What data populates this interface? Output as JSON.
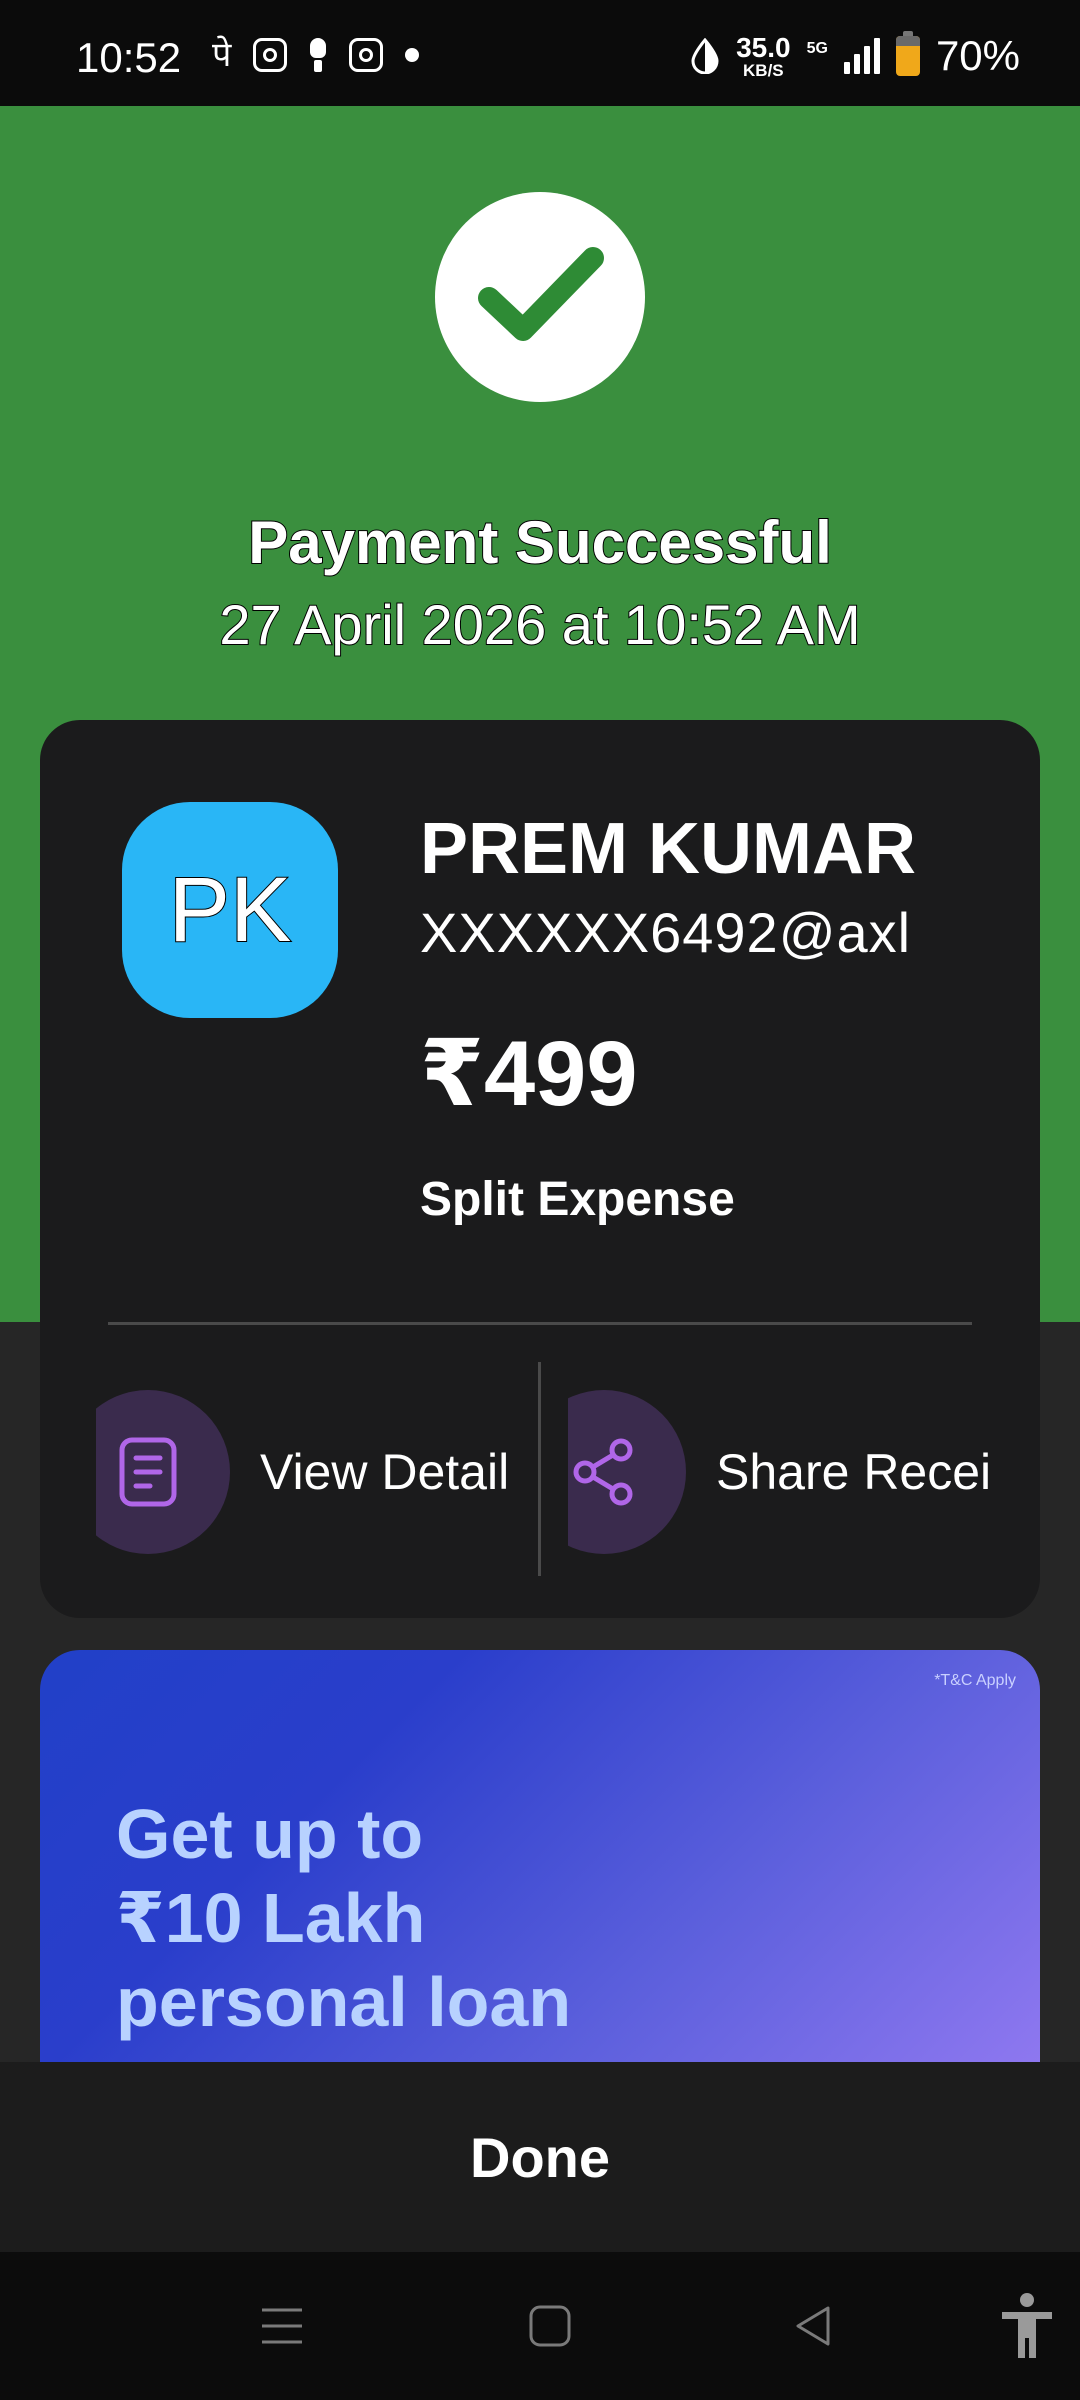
{
  "status_bar": {
    "time": "10:52",
    "notif_glyph": "पे",
    "net_speed_value": "35.0",
    "net_speed_unit": "KB/S",
    "network_type": "5G",
    "battery_percent": "70%",
    "battery_level": 0.7
  },
  "payment": {
    "status_title": "Payment Successful",
    "datetime": "27 April 2026 at 10:52 AM",
    "status_icon": "check-icon",
    "header_color": "#3a8f3e"
  },
  "payee": {
    "initials": "PK",
    "name": "PREM KUMAR",
    "upi_id": "XXXXXX6492@axl",
    "amount": "₹499",
    "note": "Split Expense",
    "avatar_color": "#29b6f6"
  },
  "actions": {
    "view_details_label": "View Detail",
    "view_details_icon": "document-icon",
    "share_receipt_label": "Share Recei",
    "share_receipt_icon": "share-icon"
  },
  "promo": {
    "tnc": "*T&C Apply",
    "line1": "Get up to",
    "line2": "₹10 Lakh",
    "line3": "personal loan"
  },
  "footer": {
    "done_label": "Done"
  },
  "nav": {
    "items": [
      "menu-icon",
      "home-icon",
      "back-icon",
      "accessibility-icon"
    ]
  }
}
